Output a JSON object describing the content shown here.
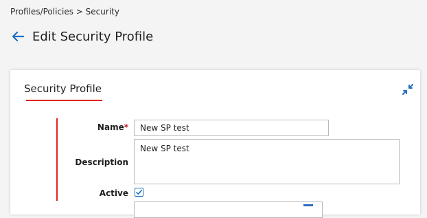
{
  "breadcrumb": {
    "text": "Profiles/Policies > Security"
  },
  "header": {
    "title": "Edit Security Profile"
  },
  "card": {
    "title": "Security Profile"
  },
  "form": {
    "name": {
      "label": "Name",
      "required_marker": "*",
      "value": "New SP test"
    },
    "description": {
      "label": "Description",
      "value": "New SP test"
    },
    "active": {
      "label": "Active",
      "checked": true
    }
  },
  "colors": {
    "accent_red": "#e0241b",
    "link_blue": "#1f6fc0",
    "required_red": "#c0101b"
  },
  "icons": {
    "back": "arrow-left-icon",
    "collapse": "collapse-arrows-icon",
    "check": "checkmark-icon"
  }
}
